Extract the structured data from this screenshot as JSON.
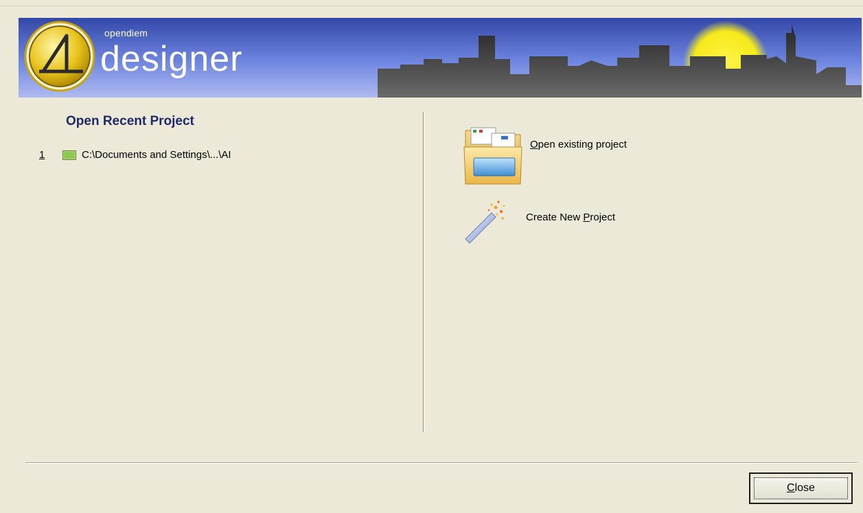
{
  "banner": {
    "brand_small": "opendiem",
    "brand_big": "designer",
    "colors": {
      "sky_top": "#3348a8",
      "sky_mid": "#6f86e0",
      "sky_bottom": "#aebbf0",
      "skyline": "#3a3a3a",
      "sun": "#f5ea1a",
      "logo_ring": "#e2b911"
    }
  },
  "recent": {
    "title": "Open Recent Project",
    "items": [
      {
        "index": "1",
        "path": "C:\\Documents and Settings\\...\\AI"
      }
    ]
  },
  "actions": {
    "open_existing": {
      "accel": "O",
      "rest": "pen existing project",
      "icon": "folder-icon"
    },
    "create_new": {
      "prefix": "Create New ",
      "accel": "P",
      "rest": "roject",
      "icon": "magic-wand-icon"
    }
  },
  "footer": {
    "close": {
      "accel": "C",
      "rest": "lose"
    }
  }
}
